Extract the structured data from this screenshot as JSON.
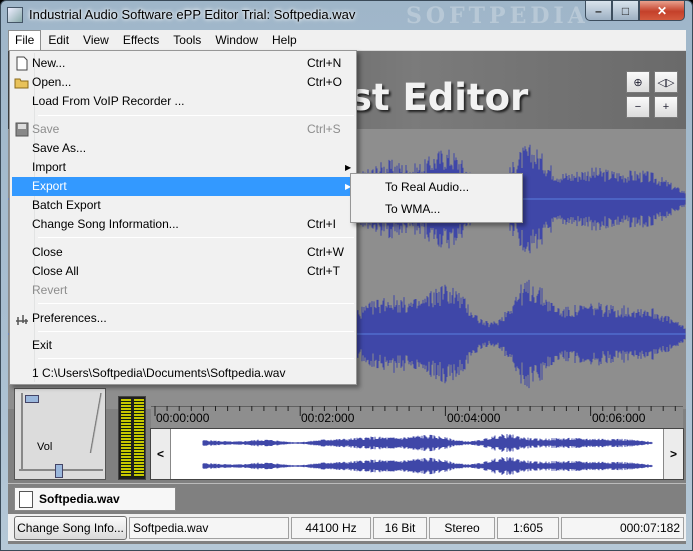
{
  "window": {
    "title": "Industrial Audio Software ePP Editor Trial: Softpedia.wav",
    "watermark": "SOFTPEDIA",
    "controls": {
      "minimize": "–",
      "maximize": "□",
      "close": "✕"
    }
  },
  "menubar": [
    "File",
    "Edit",
    "View",
    "Effects",
    "Tools",
    "Window",
    "Help"
  ],
  "banner": {
    "title": "cast Editor"
  },
  "zoom_buttons": [
    "zoom-fit",
    "zoom-horizontal",
    "zoom-out",
    "zoom-in"
  ],
  "file_menu": {
    "items": [
      {
        "label": "New...",
        "shortcut": "Ctrl+N",
        "icon": "new-file-icon"
      },
      {
        "label": "Open...",
        "shortcut": "Ctrl+O",
        "icon": "open-folder-icon"
      },
      {
        "label": "Load From VoIP Recorder ...",
        "shortcut": ""
      },
      {
        "label": "Save",
        "shortcut": "Ctrl+S",
        "disabled": true,
        "icon": "save-disk-icon"
      },
      {
        "label": "Save As...",
        "shortcut": ""
      },
      {
        "label": "Import",
        "shortcut": "",
        "submenu": true
      },
      {
        "label": "Export",
        "shortcut": "",
        "submenu": true,
        "highlighted": true
      },
      {
        "label": "Batch Export",
        "shortcut": ""
      },
      {
        "label": "Change Song Information...",
        "shortcut": "Ctrl+I"
      },
      {
        "label": "Close",
        "shortcut": "Ctrl+W"
      },
      {
        "label": "Close All",
        "shortcut": "Ctrl+T"
      },
      {
        "label": "Revert",
        "shortcut": "",
        "disabled": true
      },
      {
        "label": "Preferences...",
        "shortcut": "",
        "icon": "preferences-icon"
      },
      {
        "label": "Exit",
        "shortcut": ""
      },
      {
        "label": "1 C:\\Users\\Softpedia\\Documents\\Softpedia.wav",
        "shortcut": ""
      }
    ]
  },
  "export_submenu": [
    "To Real Audio...",
    "To WMA..."
  ],
  "volume": {
    "label": "Vol"
  },
  "timeline": {
    "ticks": [
      "00:00:000",
      "00:02:000",
      "00:04:000",
      "00:06:000"
    ]
  },
  "overview": {
    "left_arrow": "<",
    "right_arrow": ">"
  },
  "file_tab": {
    "label": "Softpedia.wav"
  },
  "statusbar": {
    "button": "Change Song Info...",
    "filename": "Softpedia.wav",
    "sample_rate": "44100 Hz",
    "bit_depth": "16 Bit",
    "channels": "Stereo",
    "ratio": "1:605",
    "duration": "000:07:182"
  },
  "colors": {
    "waveform": "#3f47a8",
    "highlight": "#3399ff",
    "centerline": "#5a7fe0"
  }
}
